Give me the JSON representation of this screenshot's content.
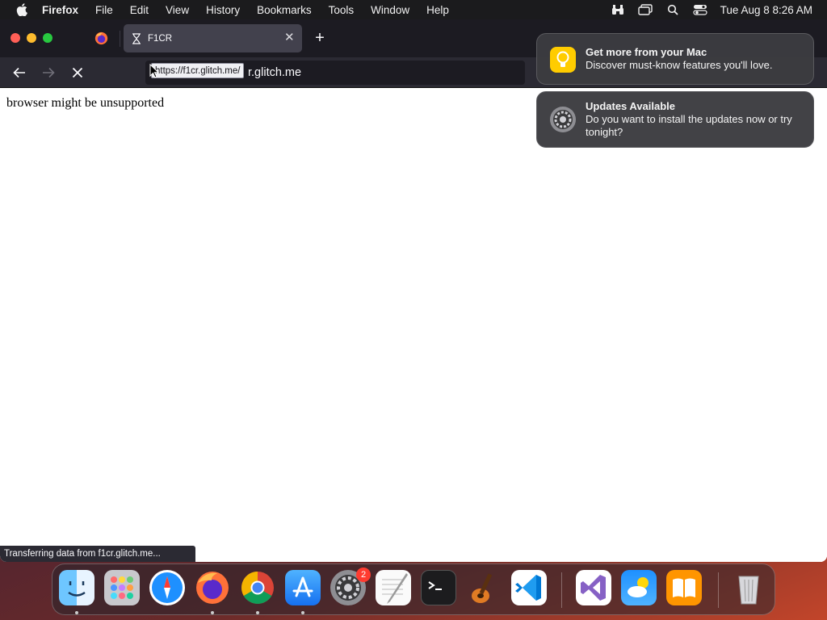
{
  "menubar": {
    "app_name": "Firefox",
    "menus": [
      "File",
      "Edit",
      "View",
      "History",
      "Bookmarks",
      "Tools",
      "Window",
      "Help"
    ],
    "clock": "Tue Aug 8  8:26 AM",
    "status_icons": [
      "binoculars-icon",
      "screen-mirroring-icon",
      "spotlight-search-icon",
      "control-center-icon"
    ]
  },
  "browser": {
    "tab_title": "F1CR",
    "tab_loading_icon": "hourglass-icon",
    "url_text": "r.glitch.me",
    "link_tooltip": "https://f1cr.glitch.me/",
    "page_text": "browser might be unsupported",
    "status_text": "Transferring data from f1cr.glitch.me..."
  },
  "notifications": [
    {
      "title": "Get more from your Mac",
      "body": "Discover must-know features you'll love.",
      "icon": "lightbulb-icon"
    },
    {
      "title": "Updates Available",
      "body": "Do you want to install the updates now or try tonight?",
      "icon": "system-settings-gear-icon"
    }
  ],
  "dock": {
    "apps": [
      "Finder",
      "Launchpad",
      "Safari",
      "Firefox",
      "Chrome",
      "App Store",
      "System Settings",
      "TextEdit",
      "Terminal",
      "GarageBand",
      "Visual Studio Code",
      "Visual Studio",
      "Weather",
      "Books",
      "Trash"
    ],
    "system_settings_badge": "2"
  },
  "colors": {
    "tabstrip": "#1c1b22",
    "navbar": "#2b2a33",
    "active_tab": "#42414d",
    "notification_bg": "#3c3c40",
    "badge": "#ff3b30"
  }
}
